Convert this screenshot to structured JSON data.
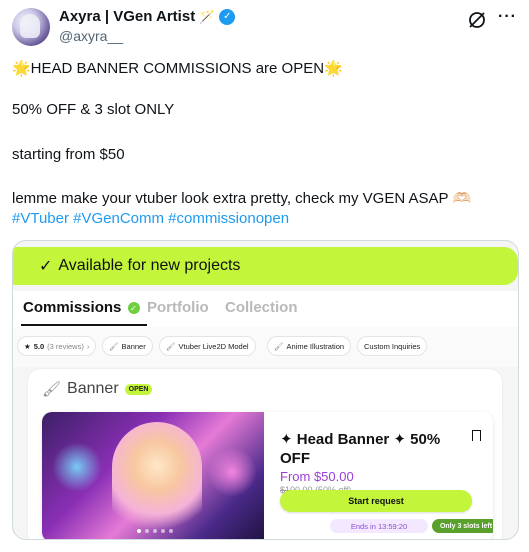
{
  "author": {
    "display_name": "Axyra | VGen Artist",
    "name_emoji": "🪄",
    "verified_mark": "✓",
    "handle": "@axyra__"
  },
  "header_actions": {
    "more": "···"
  },
  "tweet": {
    "line1": "🌟HEAD BANNER COMMISSIONS are OPEN🌟",
    "line2": "50% OFF & 3 slot ONLY",
    "line3": "starting from $50",
    "line4": "lemme make your vtuber look extra pretty, check my VGEN ASAP 🫶🏻",
    "hashtags": "#VTuber #VGenComm #commissionopen"
  },
  "media": {
    "availability": "Available for new projects",
    "availability_check": "✓",
    "tabs": [
      {
        "label": "Commissions"
      },
      {
        "label": "Portfolio"
      },
      {
        "label": "Collection"
      }
    ],
    "filters": {
      "rating": "5.0",
      "reviews": "(3 reviews)",
      "chips": [
        "Banner",
        "Vtuber Live2D Model",
        "Anime Illustration",
        "Custom Inquiries"
      ]
    },
    "section_title": "Banner",
    "open_badge": "OPEN",
    "card": {
      "title": "✦ Head Banner ✦ 50% OFF",
      "price": "From $50.00",
      "old_price": "$100.00 (50% off)",
      "button": "Start request",
      "ends": "Ends in 13:59:20",
      "slots": "Only 3 slots left"
    }
  },
  "colors": {
    "accent_lime": "#c3f53b",
    "link_blue": "#1d9bf0",
    "price_purple": "#9a3fd6"
  }
}
